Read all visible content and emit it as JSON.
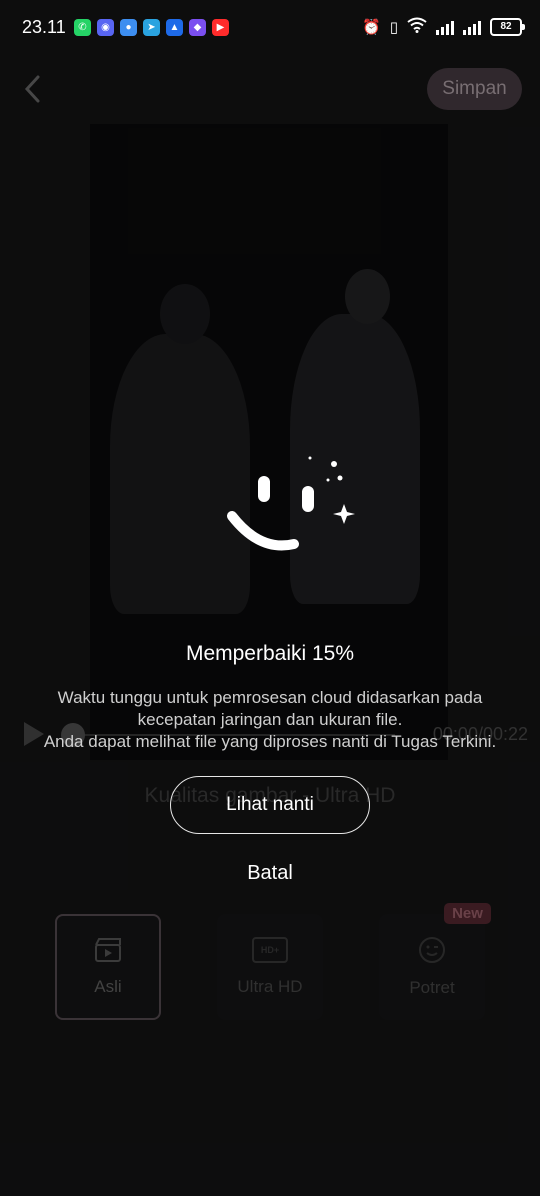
{
  "status_bar": {
    "time": "23.11",
    "battery": "82",
    "notification_icons": [
      "whatsapp-icon",
      "discord-icon",
      "chat-bubble-icon",
      "telegram-icon",
      "alert-icon",
      "app-icon",
      "youtube-icon"
    ]
  },
  "header": {
    "save_label": "Simpan"
  },
  "player": {
    "time": "00:00/00:22"
  },
  "quality": {
    "label": "Kualitas gambar - Ultra HD"
  },
  "modes": [
    {
      "label": "Asli",
      "icon": "clapperboard-icon",
      "selected": true
    },
    {
      "label": "Ultra HD",
      "icon": "hd-plus-icon",
      "icon_text": "HD+"
    },
    {
      "label": "Potret",
      "icon": "wink-face-icon",
      "badge": "New"
    }
  ],
  "processing": {
    "title": "Memperbaiki 15%",
    "progress": 15,
    "description_1": "Waktu tunggu untuk pemrosesan cloud didasarkan pada kecepatan jaringan dan ukuran file.",
    "description_2": "Anda dapat melihat file yang diproses nanti di Tugas Terkini.",
    "later_label": "Lihat nanti",
    "cancel_label": "Batal"
  },
  "colors": {
    "accent": "#4a3e45",
    "badge": "#5a2a33"
  }
}
